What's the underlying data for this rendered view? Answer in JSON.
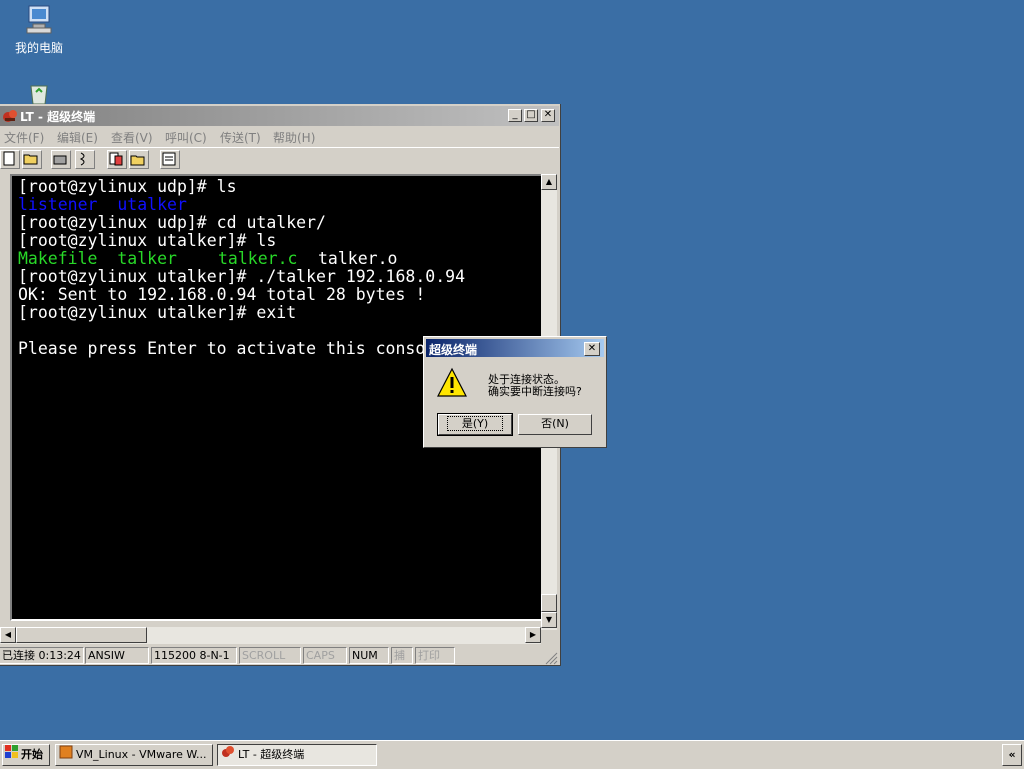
{
  "desktop": {
    "my_computer_label": "我的电脑"
  },
  "window": {
    "title": "LT - 超级终端",
    "menu": [
      "文件(F)",
      "编辑(E)",
      "查看(V)",
      "呼叫(C)",
      "传送(T)",
      "帮助(H)"
    ],
    "terminal_lines": [
      "[root@zylinux udp]# ls",
      "listener  utalker",
      "[root@zylinux udp]# cd utalker/",
      "[root@zylinux utalker]# ls",
      "Makefile  talker",
      "talker.c",
      "talker.o",
      "[root@zylinux utalker]# ./talker 192.168.0.94",
      "OK: Sent to 192.168.0.94 total 28 bytes !",
      "[root@zylinux utalker]# exit",
      "Please press Enter to activate this conso"
    ],
    "status": {
      "connected": "已连接 0:13:24",
      "emulation": "ANSIW",
      "port": "115200 8-N-1",
      "scroll": "SCROLL",
      "caps": "CAPS",
      "num": "NUM",
      "capture": "捕",
      "print": "打印"
    }
  },
  "dialog": {
    "title": "超级终端",
    "message_line1": "处于连接状态。",
    "message_line2": "确实要中断连接吗?",
    "yes_label": "是(Y)",
    "no_label": "否(N)"
  },
  "taskbar": {
    "start_label": "开始",
    "items": [
      "VM_Linux - VMware W...",
      "LT - 超级终端"
    ],
    "expand_label": "«"
  },
  "colors": {
    "desktop": "#3a6ea5",
    "terminal_bg": "#000000",
    "dir_blue": "#1010ff",
    "exec_green": "#28d828"
  }
}
